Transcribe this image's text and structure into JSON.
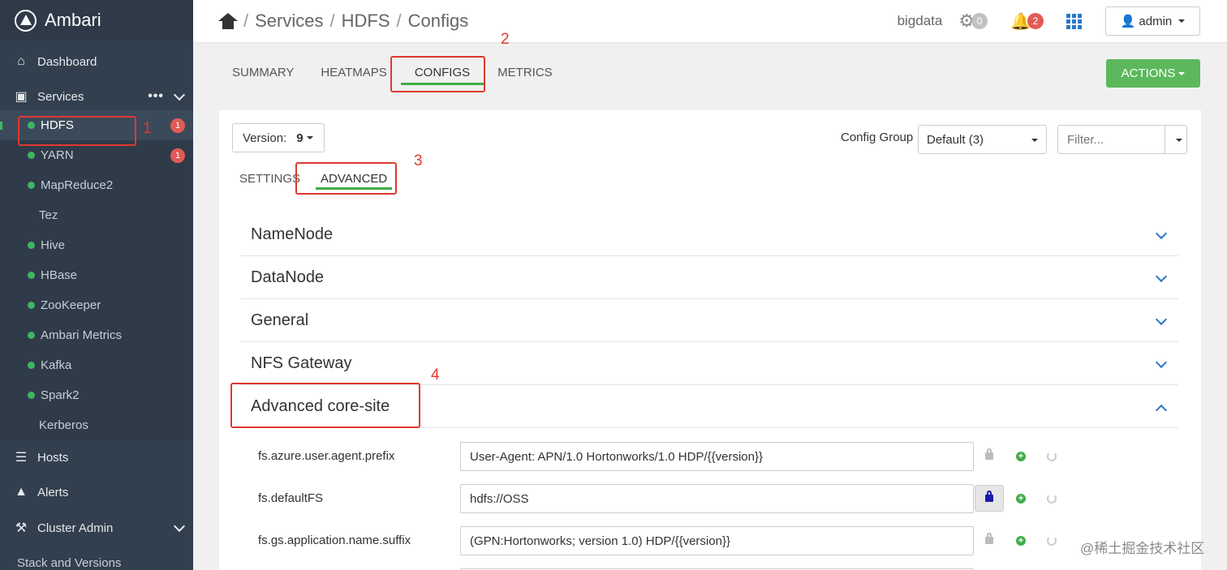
{
  "brand": {
    "name": "Ambari"
  },
  "sidebar": {
    "dashboard": "Dashboard",
    "services": "Services",
    "services_more": "•••",
    "service_items": [
      {
        "label": "HDFS",
        "status": "started",
        "badge": "1"
      },
      {
        "label": "YARN",
        "status": "started",
        "badge": "1"
      },
      {
        "label": "MapReduce2",
        "status": "started",
        "badge": ""
      },
      {
        "label": "Tez",
        "status": "none",
        "badge": ""
      },
      {
        "label": "Hive",
        "status": "started",
        "badge": ""
      },
      {
        "label": "HBase",
        "status": "started",
        "badge": ""
      },
      {
        "label": "ZooKeeper",
        "status": "started",
        "badge": ""
      },
      {
        "label": "Ambari Metrics",
        "status": "started",
        "badge": ""
      },
      {
        "label": "Kafka",
        "status": "started",
        "badge": ""
      },
      {
        "label": "Spark2",
        "status": "started",
        "badge": ""
      },
      {
        "label": "Kerberos",
        "status": "none",
        "badge": ""
      }
    ],
    "hosts": "Hosts",
    "alerts": "Alerts",
    "cluster_admin": "Cluster Admin",
    "stack_versions": "Stack and Versions"
  },
  "breadcrumb": {
    "services": "Services",
    "service": "HDFS",
    "page": "Configs",
    "sep": "/"
  },
  "topbar": {
    "cluster": "bigdata",
    "ops_count": "0",
    "alerts_count": "2",
    "user": "admin"
  },
  "tabs": [
    "SUMMARY",
    "HEATMAPS",
    "CONFIGS",
    "METRICS"
  ],
  "actions_label": "ACTIONS",
  "version": {
    "label": "Version:",
    "value": "9"
  },
  "config_group": {
    "label": "Config Group",
    "value": "Default (3)"
  },
  "filter": {
    "placeholder": "Filter..."
  },
  "subtabs": [
    "SETTINGS",
    "ADVANCED"
  ],
  "sections": [
    "NameNode",
    "DataNode",
    "General",
    "NFS Gateway",
    "Advanced core-site"
  ],
  "properties": [
    {
      "name": "fs.azure.user.agent.prefix",
      "value": "User-Agent: APN/1.0 Hortonworks/1.0 HDP/{{version}}",
      "locked": false
    },
    {
      "name": "fs.defaultFS",
      "value": "hdfs://OSS",
      "locked": true
    },
    {
      "name": "fs.gs.application.name.suffix",
      "value": " (GPN:Hortonworks; version 1.0) HDP/{{version}}",
      "locked": false
    }
  ],
  "annotations": [
    "1",
    "2",
    "3",
    "4"
  ],
  "watermark": "@稀土掘金技术社区",
  "colors": {
    "sidebar": "#323f4e",
    "accent_green": "#3fae49",
    "actions": "#5cb85c",
    "badge_red": "#e25b56",
    "annotation_red": "#e0392f",
    "link_blue": "#2b78c5"
  }
}
